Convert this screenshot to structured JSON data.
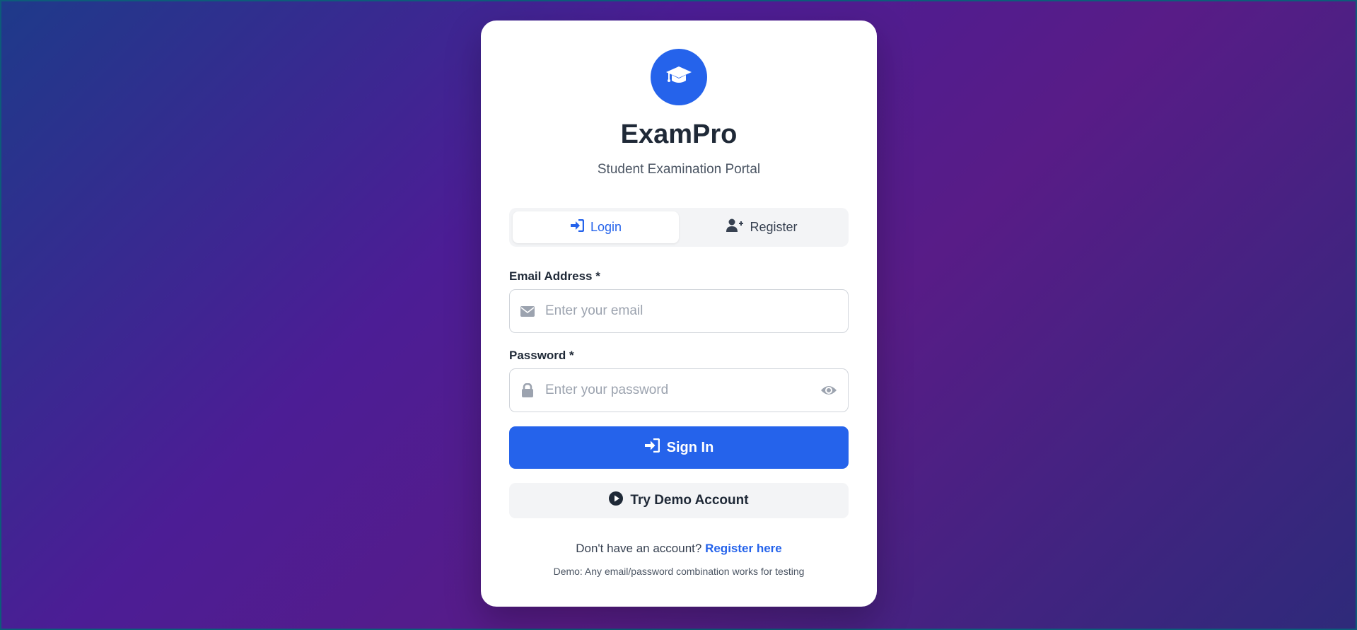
{
  "app": {
    "title": "ExamPro",
    "subtitle": "Student Examination Portal",
    "logo_icon": "graduation-cap-icon",
    "accent_color": "#2563eb"
  },
  "tabs": [
    {
      "label": "Login",
      "icon": "sign-in-icon",
      "active": true
    },
    {
      "label": "Register",
      "icon": "user-plus-icon",
      "active": false
    }
  ],
  "form": {
    "email": {
      "label": "Email Address *",
      "placeholder": "Enter your email",
      "value": "",
      "icon": "envelope-icon"
    },
    "password": {
      "label": "Password *",
      "placeholder": "Enter your password",
      "value": "",
      "icon": "lock-icon",
      "toggle_icon": "eye-icon"
    },
    "submit_label": "Sign In",
    "demo_label": "Try Demo Account"
  },
  "footer": {
    "prompt": "Don't have an account?",
    "register_link": "Register here",
    "demo_note": "Demo: Any email/password combination works for testing"
  }
}
